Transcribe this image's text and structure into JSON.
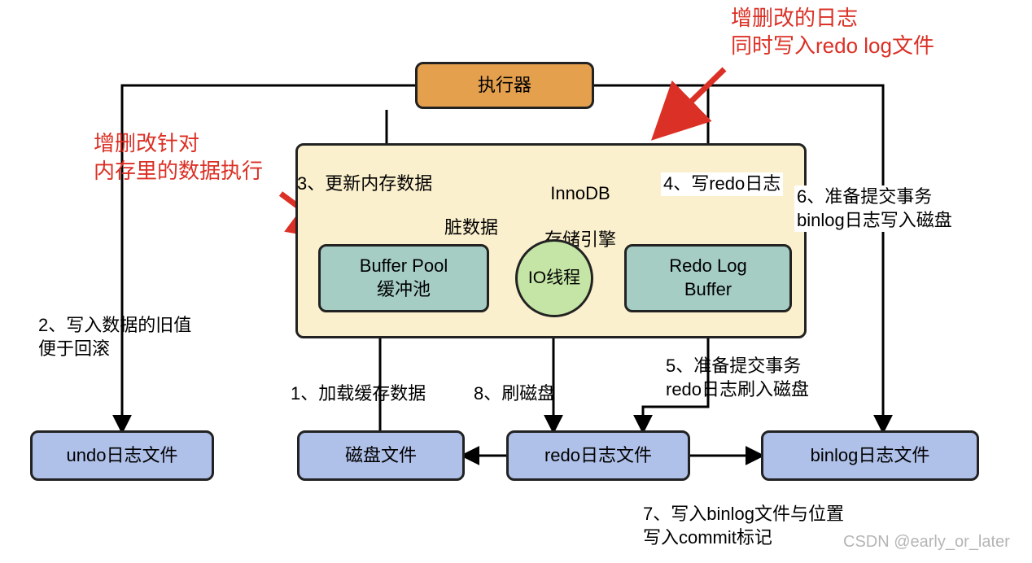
{
  "annotations": {
    "top_right_red": "增删改的日志\n同时写入redo log文件",
    "top_left_red": "增删改针对\n内存里的数据执行"
  },
  "boxes": {
    "executor": "执行器",
    "innodb_container_title_line1": "InnoDB",
    "innodb_container_title_line2": "存储引擎",
    "buffer_pool": "Buffer Pool\n缓冲池",
    "io_thread": "IO线程",
    "redo_buffer": "Redo Log\nBuffer",
    "undo_file": "undo日志文件",
    "disk_file": "磁盘文件",
    "redo_file": "redo日志文件",
    "binlog_file": "binlog日志文件"
  },
  "edges": {
    "dirty_data": "脏数据",
    "step1": "1、加载缓存数据",
    "step2": "2、写入数据的旧值\n便于回滚",
    "step3": "3、更新内存数据",
    "step4": "4、写redo日志",
    "step5": "5、准备提交事务\nredo日志刷入磁盘",
    "step6": "6、准备提交事务\nbinlog日志写入磁盘",
    "step7": "7、写入binlog文件与位置\n写入commit标记",
    "step8": "8、刷磁盘"
  },
  "watermark": "CSDN @early_or_later"
}
